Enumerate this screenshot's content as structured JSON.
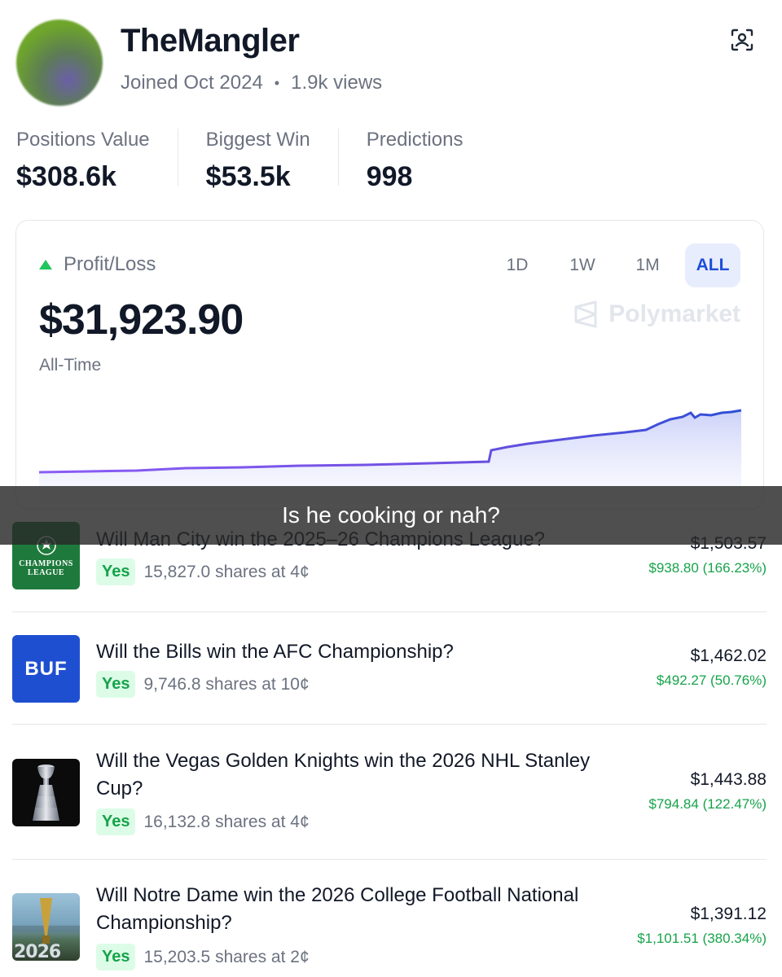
{
  "profile": {
    "username": "TheMangler",
    "joined": "Joined Oct 2024",
    "views": "1.9k views"
  },
  "stats": [
    {
      "label": "Positions Value",
      "value": "$308.6k"
    },
    {
      "label": "Biggest Win",
      "value": "$53.5k"
    },
    {
      "label": "Predictions",
      "value": "998"
    }
  ],
  "pl": {
    "label": "Profit/Loss",
    "value": "$31,923.90",
    "period": "All-Time",
    "ranges": [
      "1D",
      "1W",
      "1M",
      "ALL"
    ],
    "active_range": "ALL",
    "watermark": "Polymarket"
  },
  "caption": "Is he cooking or nah?",
  "positions": [
    {
      "title": "Will Man City win the 2025–26 Champions League?",
      "outcome": "Yes",
      "shares": "15,827.0 shares at 4¢",
      "value": "$1,503.57",
      "pnl": "$938.80 (166.23%)",
      "thumb_text": "CHAMPIONS LEAGUE"
    },
    {
      "title": "Will the Bills win the AFC Championship?",
      "outcome": "Yes",
      "shares": "9,746.8 shares at 10¢",
      "value": "$1,462.02",
      "pnl": "$492.27 (50.76%)",
      "thumb_text": "BUF"
    },
    {
      "title": "Will the Vegas Golden Knights win the 2026 NHL Stanley Cup?",
      "outcome": "Yes",
      "shares": "16,132.8 shares at 4¢",
      "value": "$1,443.88",
      "pnl": "$794.84 (122.47%)",
      "thumb_text": ""
    },
    {
      "title": "Will Notre Dame win the 2026 College Football National Championship?",
      "outcome": "Yes",
      "shares": "15,203.5 shares at 2¢",
      "value": "$1,391.12",
      "pnl": "$1,101.51 (380.34%)",
      "thumb_text": "2026"
    }
  ],
  "colors": {
    "accent": "#1d4ed8",
    "positive": "#16a34a",
    "line_start": "#8b5cf6",
    "line_end": "#2f4fd6"
  },
  "icons": {
    "profile_action": "scan-face-icon",
    "pl_indicator": "triangle-up-icon",
    "watermark_logo": "polymarket-logo-icon"
  }
}
